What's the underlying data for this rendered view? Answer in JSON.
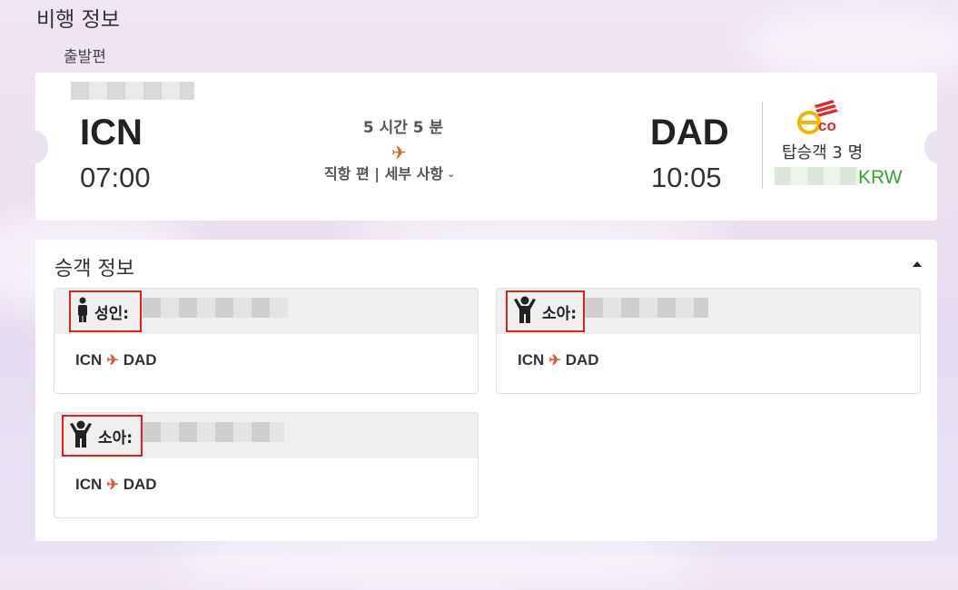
{
  "page": {
    "section_title": "비행 정보",
    "leg_title": "출발편"
  },
  "flight": {
    "origin_code": "ICN",
    "depart_time": "07:00",
    "destination_code": "DAD",
    "arrive_time": "10:05",
    "duration": "5 시간 5 분",
    "plane_icon": "airplane-icon",
    "details_label": "직항 편 | 세부 사항",
    "fare_logo_text": "eco",
    "passengers": "탑승객 3 명",
    "currency": "KRW",
    "colors": {
      "accent_orange": "#e65a2a",
      "eco_yellow": "#f2b800",
      "eco_red": "#e02b2b",
      "price_green": "#3aa235"
    }
  },
  "passenger_panel": {
    "title": "승객 정보",
    "cards": [
      {
        "type_label": "성인:",
        "icon": "adult-person-icon",
        "origin": "ICN",
        "destination": "DAD"
      },
      {
        "type_label": "소아:",
        "icon": "child-person-icon",
        "origin": "ICN",
        "destination": "DAD"
      },
      {
        "type_label": "소아:",
        "icon": "child-person-icon",
        "origin": "ICN",
        "destination": "DAD"
      }
    ]
  }
}
